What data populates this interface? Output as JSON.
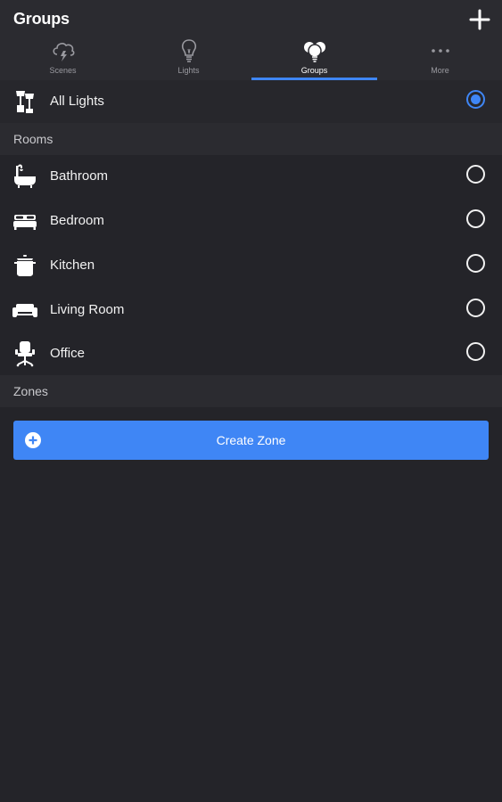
{
  "header": {
    "title": "Groups",
    "add_icon": "plus-icon"
  },
  "tabs": [
    {
      "label": "Scenes",
      "icon": "cloud-storm-icon",
      "active": false
    },
    {
      "label": "Lights",
      "icon": "bulb-icon",
      "active": false
    },
    {
      "label": "Groups",
      "icon": "bulbs-cluster-icon",
      "active": true
    },
    {
      "label": "More",
      "icon": "more-dots-icon",
      "active": false
    }
  ],
  "all_lights": {
    "label": "All Lights",
    "icon": "all-lights-icon",
    "selected": true
  },
  "rooms": {
    "header": "Rooms",
    "items": [
      {
        "label": "Bathroom",
        "icon": "bathtub-icon",
        "selected": false
      },
      {
        "label": "Bedroom",
        "icon": "bed-icon",
        "selected": false
      },
      {
        "label": "Kitchen",
        "icon": "pot-icon",
        "selected": false
      },
      {
        "label": "Living Room",
        "icon": "sofa-icon",
        "selected": false
      },
      {
        "label": "Office",
        "icon": "office-chair-icon",
        "selected": false
      }
    ]
  },
  "zones": {
    "header": "Zones",
    "create_label": "Create Zone",
    "create_icon": "plus-circle-icon"
  },
  "colors": {
    "accent": "#3f86f5",
    "background": "#242429",
    "header_background": "#2b2b30"
  }
}
